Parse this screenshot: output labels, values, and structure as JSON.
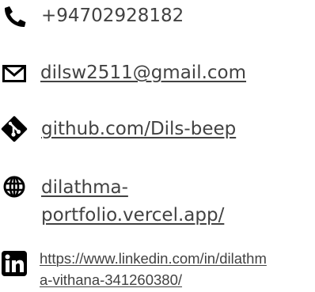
{
  "contacts": {
    "phone": {
      "icon": "phone-icon",
      "text": "+94702928182"
    },
    "email": {
      "icon": "envelope-icon",
      "text": "dilsw2511@gmail.com"
    },
    "github": {
      "icon": "git-icon",
      "text": "github.com/Dils-beep "
    },
    "portfolio": {
      "icon": "globe-icon",
      "line1": "dilathma-",
      "line2": "portfolio.vercel.app/"
    },
    "linkedin": {
      "icon": "linkedin-icon",
      "line1": "https://www.linkedin.com/in/dilathm",
      "line2": "a-vithana-341260380/"
    }
  },
  "colors": {
    "icon": "#000000",
    "text": "#424242"
  }
}
